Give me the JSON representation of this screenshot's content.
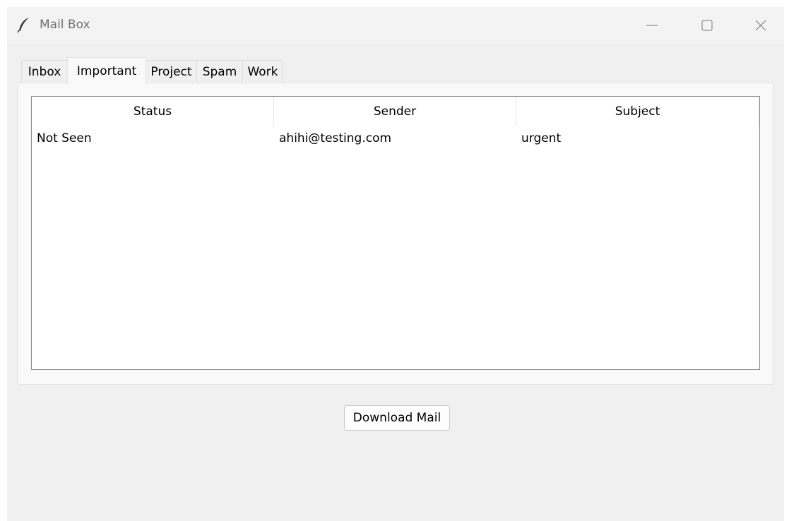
{
  "window": {
    "title": "Mail Box",
    "icon": "feather-icon"
  },
  "tabs": [
    {
      "label": "Inbox",
      "active": false
    },
    {
      "label": "Important",
      "active": true
    },
    {
      "label": "Project",
      "active": false
    },
    {
      "label": "Spam",
      "active": false
    },
    {
      "label": "Work",
      "active": false
    }
  ],
  "table": {
    "columns": [
      "Status",
      "Sender",
      "Subject"
    ],
    "rows": [
      {
        "status": "Not Seen",
        "sender": "ahihi@testing.com",
        "subject": "urgent"
      }
    ]
  },
  "actions": {
    "download_label": "Download Mail"
  }
}
